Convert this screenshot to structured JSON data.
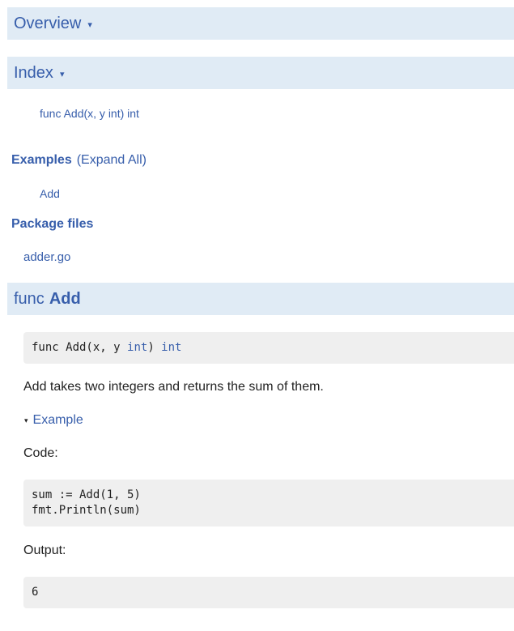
{
  "overview": {
    "title": "Overview",
    "arrow": "▾"
  },
  "index": {
    "title": "Index",
    "arrow": "▾",
    "items": [
      "func Add(x, y int) int"
    ]
  },
  "examples": {
    "title": "Examples",
    "expand_all": "(Expand All)",
    "items": [
      "Add"
    ]
  },
  "package_files": {
    "title": "Package files",
    "files": [
      "adder.go"
    ]
  },
  "func_add": {
    "prefix": "func",
    "name": "Add",
    "signature_pre": "func Add(x, y ",
    "signature_type1": "int",
    "signature_mid": ") ",
    "signature_type2": "int",
    "description": "Add takes two integers and returns the sum of them.",
    "example_toggle": "Example",
    "example_arrow": "▾",
    "code_label": "Code:",
    "code_line1": "sum := Add(1, 5)",
    "code_line2": "fmt.Println(sum)",
    "output_label": "Output:",
    "output_value": "6"
  },
  "colors": {
    "link": "#375eab",
    "section_bg": "#e0ebf5",
    "code_bg": "#efefef"
  }
}
